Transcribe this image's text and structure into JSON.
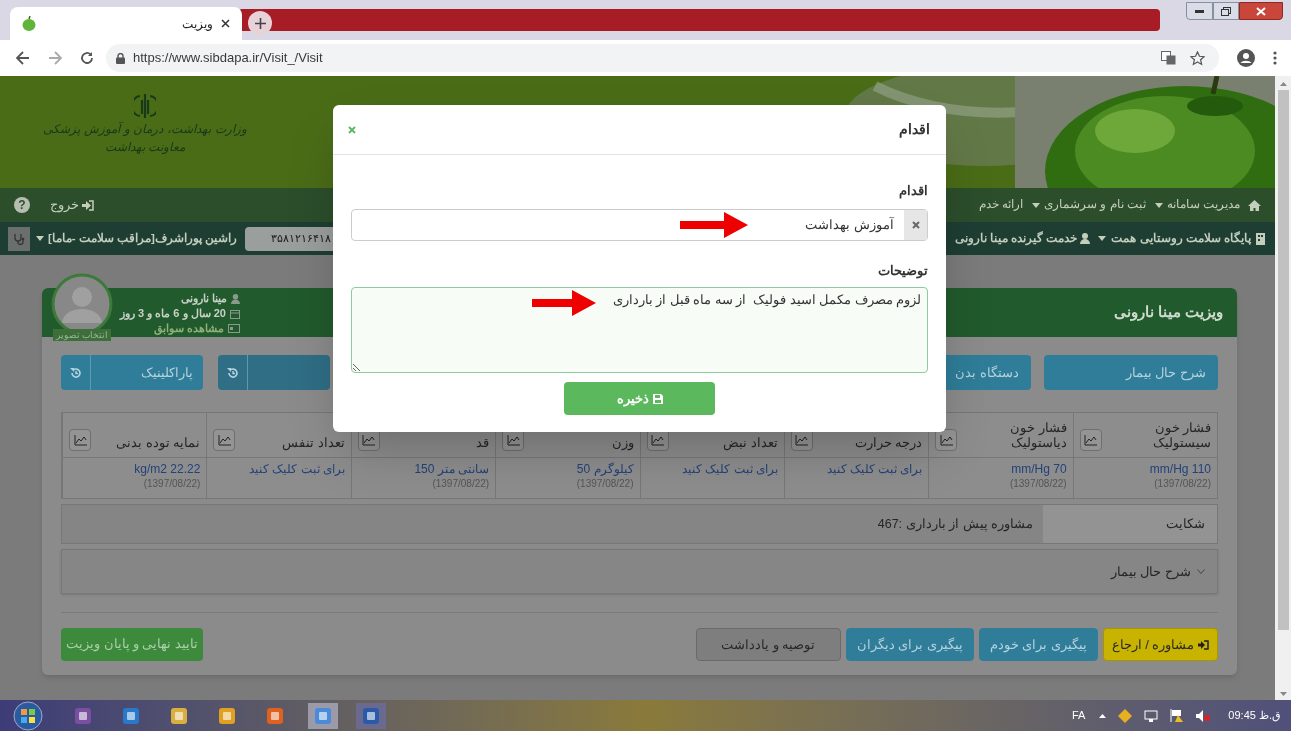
{
  "browser": {
    "tab": {
      "title": "ویزیت",
      "selected": true
    },
    "url": "https://www.sibdapa.ir/Visit_/Visit"
  },
  "header": {
    "ministry": "وزارت بهداشت، درمان و آموزش پزشکی",
    "department": "معاونت بهداشت"
  },
  "nav": {
    "menus": [
      {
        "label": "مدیریت سامانه",
        "dropdown": true
      },
      {
        "label": "ثبت نام و سرشماری",
        "dropdown": true
      },
      {
        "label": "ارائه خدم",
        "dropdown": false
      }
    ],
    "logout": "خروج",
    "help": "?"
  },
  "subnav": {
    "center": "پایگاه سلامت روستایی همت",
    "client": "خدمت گیرنده مینا نارونی",
    "code": "۳۵۸۱۲۱۶۴۱۸",
    "user": "راشین پوراشرف[مراقب سلامت -ماما]"
  },
  "visit": {
    "title": "ویزیت مینا نارونی",
    "patient": {
      "name": "مینا نارونی",
      "age": "20 سال و 6 ماه و 3 روز",
      "history": "مشاهده سوابق",
      "photo_label": "انتخاب تصویر"
    },
    "sections": [
      {
        "label": "شرح حال بیمار"
      },
      {
        "label": "دستگاه بدن"
      }
    ],
    "tools": [
      {
        "kind": "icon"
      },
      {
        "kind": "labeled",
        "label": "پاراکلینیک"
      }
    ],
    "vitals": [
      {
        "label": "فشار خون سیستولیک",
        "value": "mm/Hg 110",
        "date": "(1397/08/22)"
      },
      {
        "label": "فشار خون دیاستولیک",
        "value": "mm/Hg 70",
        "date": "(1397/08/22)"
      },
      {
        "label": "درجه حرارت",
        "action": "برای ثبت کلیک کنید"
      },
      {
        "label": "تعداد نبض",
        "action": "برای ثبت کلیک کنید"
      },
      {
        "label": "وزن",
        "value": "50 کیلوگرم",
        "date": "(1397/08/22)"
      },
      {
        "label": "قد",
        "value": "150 سانتی متر",
        "date": "(1397/08/22)"
      },
      {
        "label": "تعداد تنفس",
        "action": "برای ثبت کلیک کنید"
      },
      {
        "label": "نمایه توده بدنی",
        "value": "kg/m2 22.22",
        "date": "(1397/08/22)"
      }
    ],
    "complaint": {
      "label": "شکایت",
      "value": "467: مشاوره پیش از بارداری"
    },
    "history_panel": {
      "label": "شرح حال بیمار",
      "expanded": false
    },
    "actions": [
      {
        "label": "مشاوره / ارجاع",
        "kind": "warning"
      },
      {
        "label": "پیگیری برای خودم",
        "kind": "info"
      },
      {
        "label": "پیگیری برای دیگران",
        "kind": "info"
      },
      {
        "label": "توصیه و یادداشت",
        "kind": "default"
      }
    ],
    "finish": "تایید نهایی و پایان ویزیت"
  },
  "modal": {
    "title": "اقدام",
    "action_label": "اقدام",
    "action_value": "آموزش بهداشت",
    "notes_label": "توضیحات",
    "notes_value": "لزوم مصرف مکمل اسید فولیک  از سه ماه قبل از بارداری",
    "save": "ذخیره"
  },
  "taskbar": {
    "language": "FA",
    "clock": "ق.ظ 09:45"
  }
}
